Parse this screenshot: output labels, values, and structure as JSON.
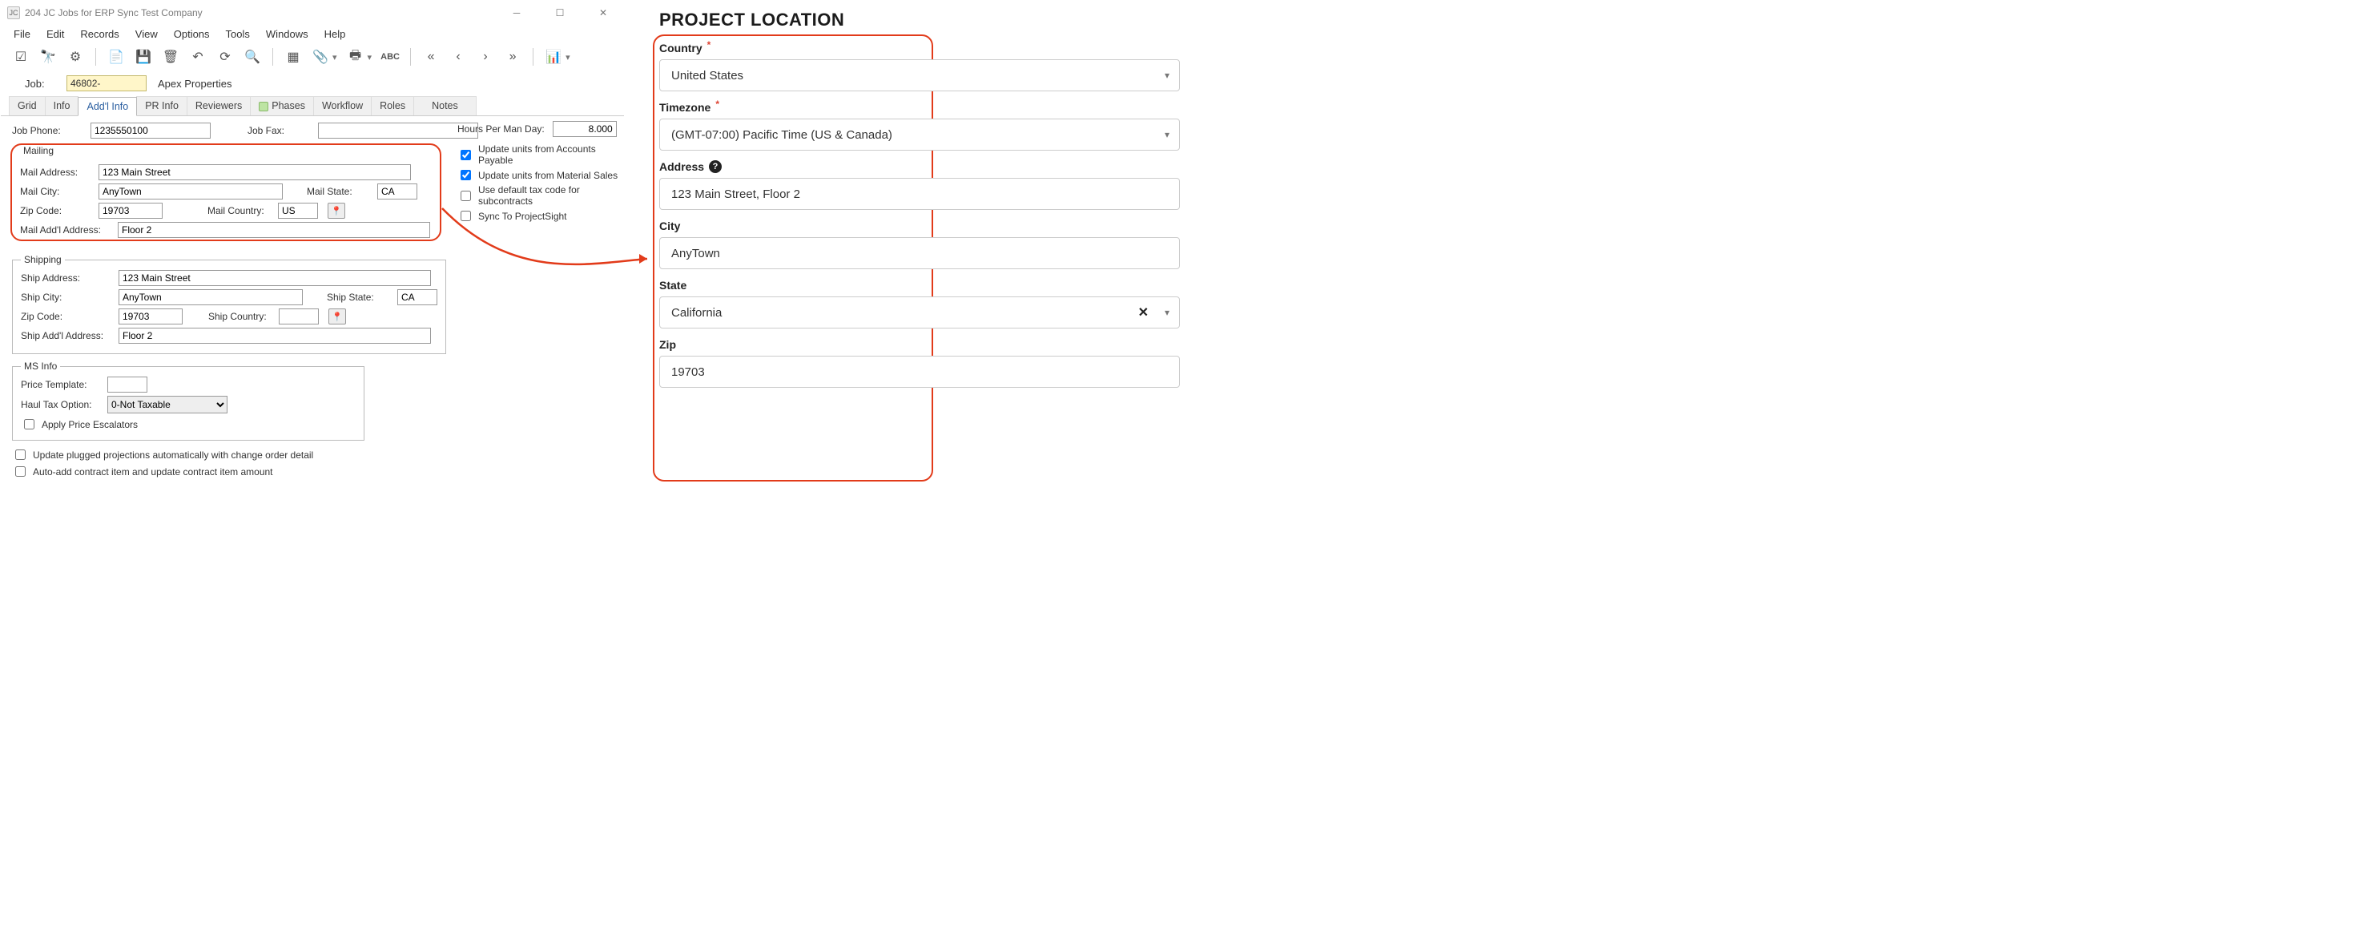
{
  "titlebar": {
    "icon_text": "JC",
    "title": "204 JC Jobs for ERP Sync Test Company"
  },
  "menubar": [
    "File",
    "Edit",
    "Records",
    "View",
    "Options",
    "Tools",
    "Windows",
    "Help"
  ],
  "jobline": {
    "job_label": "Job:",
    "job_value": "46802-",
    "job_name": "Apex Properties"
  },
  "tabs": [
    "Grid",
    "Info",
    "Add'l Info",
    "PR Info",
    "Reviewers",
    "Phases",
    "Workflow",
    "Roles",
    "Notes"
  ],
  "form": {
    "job_phone_label": "Job Phone:",
    "job_phone": "1235550100",
    "job_fax_label": "Job Fax:",
    "hours_per_man_day_label": "Hours Per Man Day:",
    "hours_per_man_day": "8.000",
    "checks": {
      "update_ap": "Update units from Accounts Payable",
      "update_ms": "Update units from Material Sales",
      "use_default_tax": "Use default tax code for subcontracts",
      "sync_ps": "Sync To ProjectSight"
    },
    "mailing": {
      "legend": "Mailing",
      "mail_address_label": "Mail Address:",
      "mail_address": "123 Main Street",
      "mail_city_label": "Mail City:",
      "mail_city": "AnyTown",
      "mail_state_label": "Mail State:",
      "mail_state": "CA",
      "zip_label": "Zip Code:",
      "zip": "19703",
      "mail_country_label": "Mail Country:",
      "mail_country": "US",
      "mail_addl_label": "Mail Add'l Address:",
      "mail_addl": "Floor 2"
    },
    "shipping": {
      "legend": "Shipping",
      "ship_address_label": "Ship Address:",
      "ship_address": "123 Main Street",
      "ship_city_label": "Ship City:",
      "ship_city": "AnyTown",
      "ship_state_label": "Ship State:",
      "ship_state": "CA",
      "zip_label": "Zip Code:",
      "zip": "19703",
      "ship_country_label": "Ship Country:",
      "ship_addl_label": "Ship Add'l Address:",
      "ship_addl": "Floor 2"
    },
    "msinfo": {
      "legend": "MS Info",
      "price_template_label": "Price Template:",
      "haul_tax_label": "Haul Tax Option:",
      "haul_tax_value": "0-Not Taxable",
      "apply_escalators": "Apply Price Escalators"
    },
    "bottom": {
      "update_plugged": "Update plugged projections automatically with change order detail",
      "auto_add": "Auto-add contract item and update contract item amount"
    }
  },
  "webform": {
    "heading": "PROJECT LOCATION",
    "country_label": "Country",
    "country": "United States",
    "timezone_label": "Timezone",
    "timezone": "(GMT-07:00) Pacific Time (US & Canada)",
    "address_label": "Address",
    "address": "123 Main Street, Floor 2",
    "city_label": "City",
    "city": "AnyTown",
    "state_label": "State",
    "state": "California",
    "zip_label": "Zip",
    "zip": "19703"
  }
}
